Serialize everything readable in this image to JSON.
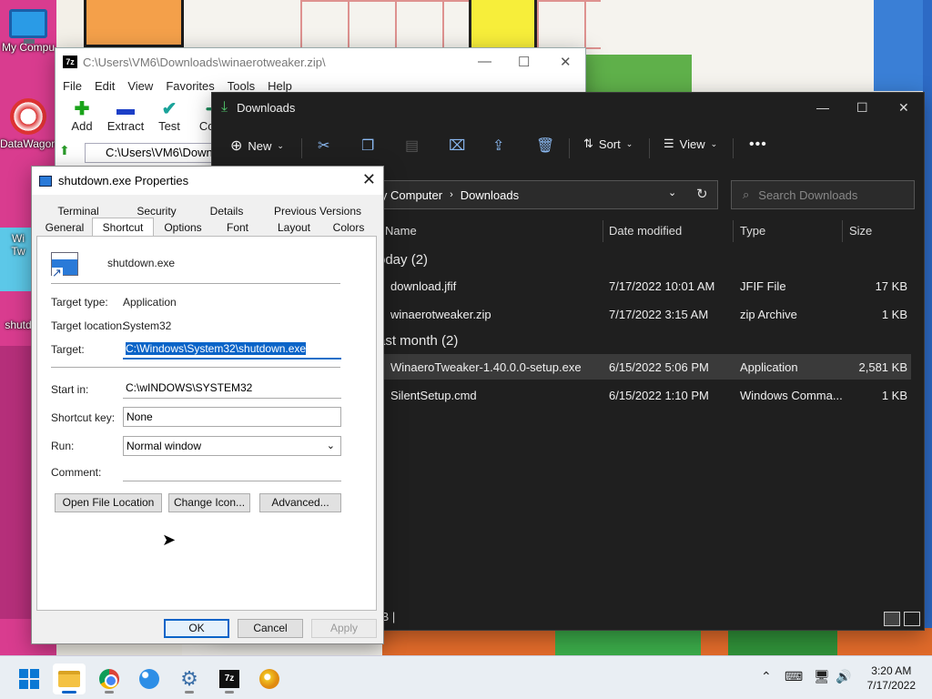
{
  "desktop": {
    "icons": [
      {
        "label": "My Compu"
      },
      {
        "label": "DataWagon"
      },
      {
        "label": "Wi"
      },
      {
        "label": "Tw"
      },
      {
        "label": "shutd"
      }
    ]
  },
  "zip_window": {
    "title": "C:\\Users\\VM6\\Downloads\\winaerotweaker.zip\\",
    "menu": [
      "File",
      "Edit",
      "View",
      "Favorites",
      "Tools",
      "Help"
    ],
    "tools": [
      "Add",
      "Extract",
      "Test",
      "Copy"
    ],
    "path_value": "C:\\Users\\VM6\\Downlo"
  },
  "explorer": {
    "title": "Downloads",
    "commands": {
      "new": "New",
      "sort": "Sort",
      "view": "View"
    },
    "address": {
      "parent": "ly Computer",
      "current": "Downloads"
    },
    "search_placeholder": "Search Downloads",
    "columns": {
      "name": "Name",
      "date": "Date modified",
      "type": "Type",
      "size": "Size"
    },
    "groups": [
      {
        "label": "oday (2)",
        "files": [
          {
            "name": "download.jfif",
            "date": "7/17/2022 10:01 AM",
            "type": "JFIF File",
            "size": "17 KB"
          },
          {
            "name": "winaerotweaker.zip",
            "date": "7/17/2022 3:15 AM",
            "type": "zip Archive",
            "size": "1 KB"
          }
        ]
      },
      {
        "label": "ast month (2)",
        "files": [
          {
            "name": "WinaeroTweaker-1.40.0.0-setup.exe",
            "date": "6/15/2022 5:06 PM",
            "type": "Application",
            "size": "2,581 KB"
          },
          {
            "name": "SilentSetup.cmd",
            "date": "6/15/2022 1:10 PM",
            "type": "Windows Comma...",
            "size": "1 KB"
          }
        ]
      }
    ],
    "status": "IB  |"
  },
  "props": {
    "title": "shutdown.exe Properties",
    "tabs_row1": [
      "Terminal",
      "Security",
      "Details",
      "Previous Versions"
    ],
    "tabs_row2": [
      "General",
      "Shortcut",
      "Options",
      "Font",
      "Layout",
      "Colors"
    ],
    "file_name": "shutdown.exe",
    "target_type_label": "Target type:",
    "target_type_value": "Application",
    "target_location_label": "Target location:",
    "target_location_value": "System32",
    "target_label": "Target:",
    "target_value": "C:\\Windows\\System32\\shutdown.exe",
    "start_in_label": "Start in:",
    "start_in_value": "C:\\wINDOWS\\SYSTEM32",
    "shortcut_key_label": "Shortcut key:",
    "shortcut_key_value": "None",
    "run_label": "Run:",
    "run_value": "Normal window",
    "comment_label": "Comment:",
    "comment_value": "",
    "buttons": {
      "open_location": "Open File Location",
      "change_icon": "Change Icon...",
      "advanced": "Advanced...",
      "ok": "OK",
      "cancel": "Cancel",
      "apply": "Apply"
    }
  },
  "taskbar": {
    "time": "3:20 AM",
    "date": "7/17/2022"
  }
}
